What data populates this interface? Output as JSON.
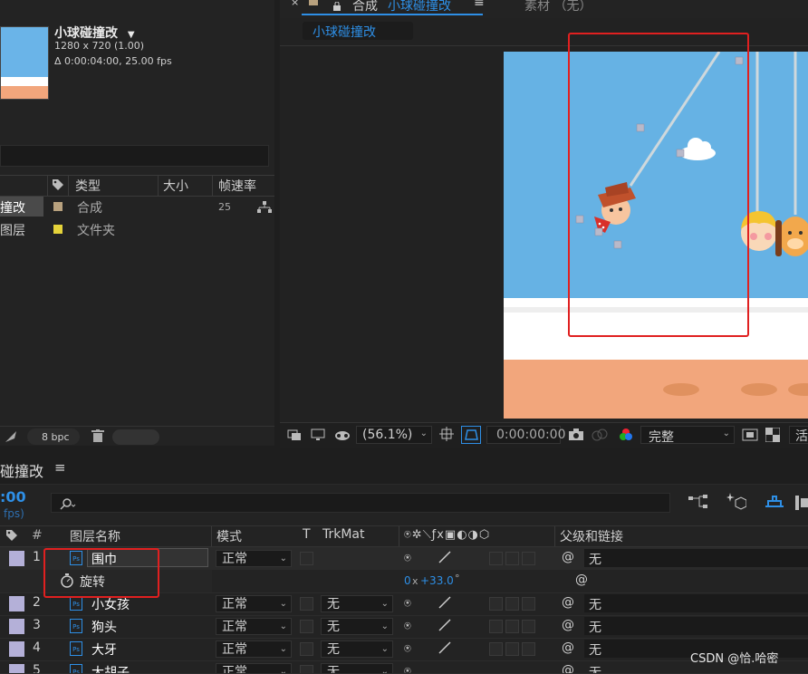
{
  "project": {
    "comp_name": "小球碰撞改",
    "comp_size": "1280 x 720 (1.00)",
    "comp_duration": "Δ 0:00:04:00, 25.00 fps",
    "columns": {
      "type": "类型",
      "size": "大小",
      "fps": "帧速率"
    },
    "rows": [
      {
        "name": "撞改",
        "color": "#b8a17e",
        "type": "合成",
        "fps": "25"
      },
      {
        "name": "图层",
        "color": "#e5d33a",
        "type": "文件夹",
        "fps": ""
      }
    ],
    "bpc": "8 bpc"
  },
  "viewer": {
    "tab_prefix": "合成",
    "tab_name": "小球碰撞改",
    "tab_menu": "≡",
    "footage_tab": "素材 （无）",
    "breadcrumb": "小球碰撞改",
    "zoom": "(56.1%)",
    "timecode": "0:00:00:00",
    "quality": "完整",
    "extra": "活"
  },
  "timeline": {
    "title": "碰撞改",
    "title_menu": "≡",
    "time": ":00",
    "fps": "fps)",
    "col_headers": {
      "name": "图层名称",
      "mode": "模式",
      "t": "T",
      "trkmat": "TrkMat",
      "parent": "父级和链接"
    },
    "layers": [
      {
        "index": "1",
        "name": "围巾",
        "mode": "正常",
        "trkmat": "",
        "parent": "无"
      },
      {
        "index": "2",
        "name": "小女孩",
        "mode": "正常",
        "trkmat": "无",
        "parent": "无"
      },
      {
        "index": "3",
        "name": "狗头",
        "mode": "正常",
        "trkmat": "无",
        "parent": "无"
      },
      {
        "index": "4",
        "name": "大牙",
        "mode": "正常",
        "trkmat": "无",
        "parent": "无"
      },
      {
        "index": "5",
        "name": "大胡子",
        "mode": "正常",
        "trkmat": "无",
        "parent": "无"
      }
    ],
    "property": {
      "name": "旋转",
      "value_turns": "0",
      "value_x": "x",
      "value_deg": "+33.0",
      "deg_sym": "°"
    }
  },
  "watermark": "CSDN @恰.哈密",
  "colors": {
    "accent": "#2e8fe6",
    "highlight": "#e02020",
    "sky": "#66b2e4",
    "sand": "#f2a67c"
  }
}
